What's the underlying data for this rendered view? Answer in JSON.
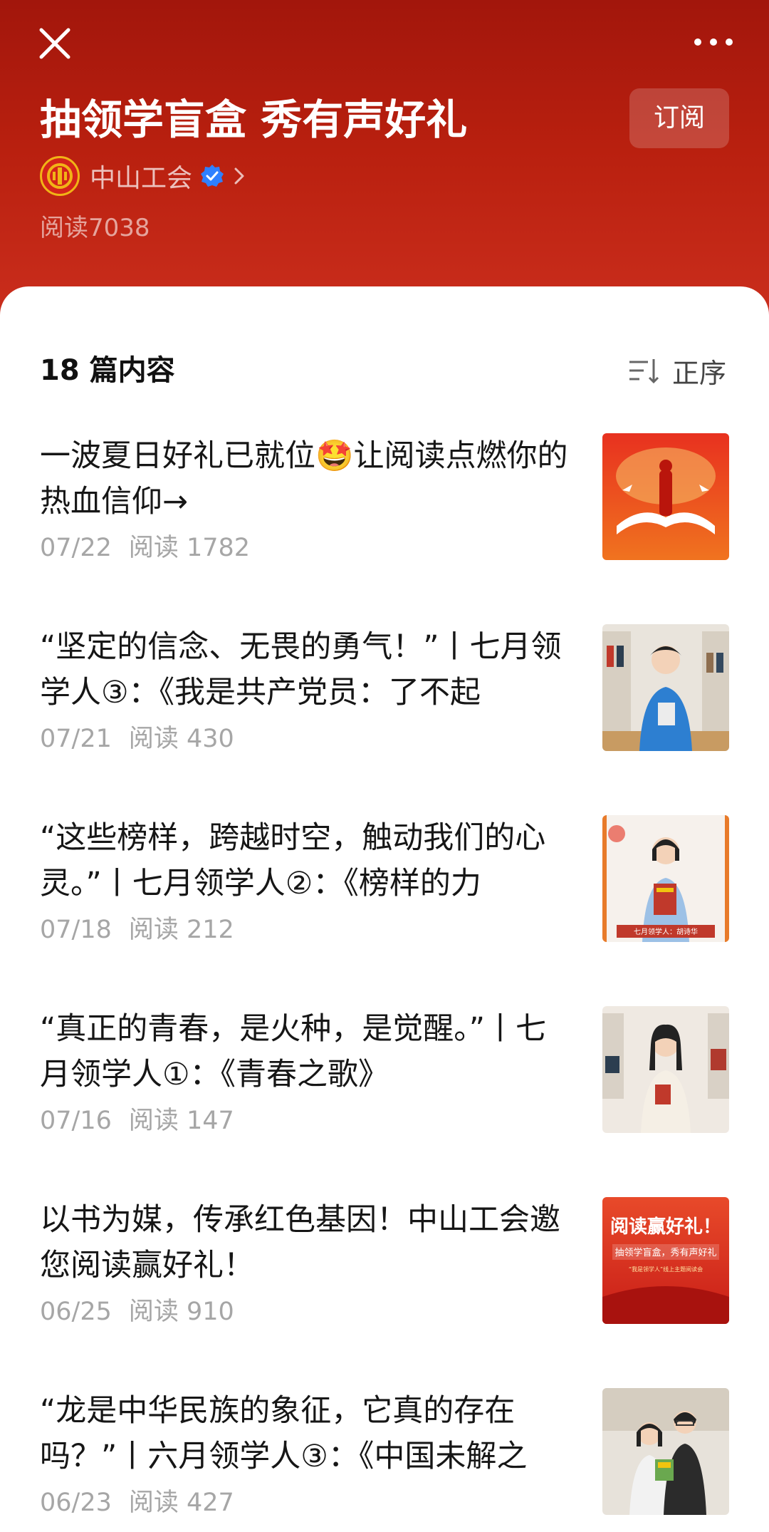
{
  "header": {
    "title": "抽领学盲盒 秀有声好礼",
    "subscribe_label": "订阅",
    "account_name": "中山工会",
    "read_total": "阅读7038"
  },
  "list": {
    "count_label": "18 篇内容",
    "sort_label": "正序"
  },
  "articles": [
    {
      "title": "一波夏日好礼已就位🤩让阅读点燃你的热血信仰→",
      "date": "07/22",
      "reads": "阅读 1782",
      "thumb": "red-book-banner-thumbnail"
    },
    {
      "title": "“坚定的信念、无畏的勇气！”丨七月领学人③：《我是共产党员：了不起",
      "date": "07/21",
      "reads": "阅读 430",
      "thumb": "woman-blue-shirt-thumbnail"
    },
    {
      "title": "“这些榜样，跨越时空，触动我们的心灵。”丨七月领学人②：《榜样的力",
      "date": "07/18",
      "reads": "阅读 212",
      "thumb": "woman-holding-book-thumbnail",
      "caption": "七月领学人：胡诗华"
    },
    {
      "title": "“真正的青春，是火种，是觉醒。”丨七月领学人①：《青春之歌》",
      "date": "07/16",
      "reads": "阅读 147",
      "thumb": "woman-white-jacket-thumbnail"
    },
    {
      "title": "以书为媒，传承红色基因！中山工会邀您阅读赢好礼！",
      "date": "06/25",
      "reads": "阅读 910",
      "thumb": "poster-thumbnail",
      "poster_line1": "阅读赢好礼！",
      "poster_line2": "抽领学盲盒，秀有声好礼",
      "poster_line3": "“我是领学人”线上主题阅读会"
    },
    {
      "title": "“龙是中华民族的象征，它真的存在吗？”丨六月领学人③：《中国未解之",
      "date": "06/23",
      "reads": "阅读 427",
      "thumb": "two-people-thumbnail"
    }
  ],
  "colors": {
    "header_top": "#a2160c",
    "header_bottom": "#cc2f1e",
    "meta_gray": "#a6a6a6",
    "verified_blue": "#2f80ff"
  }
}
